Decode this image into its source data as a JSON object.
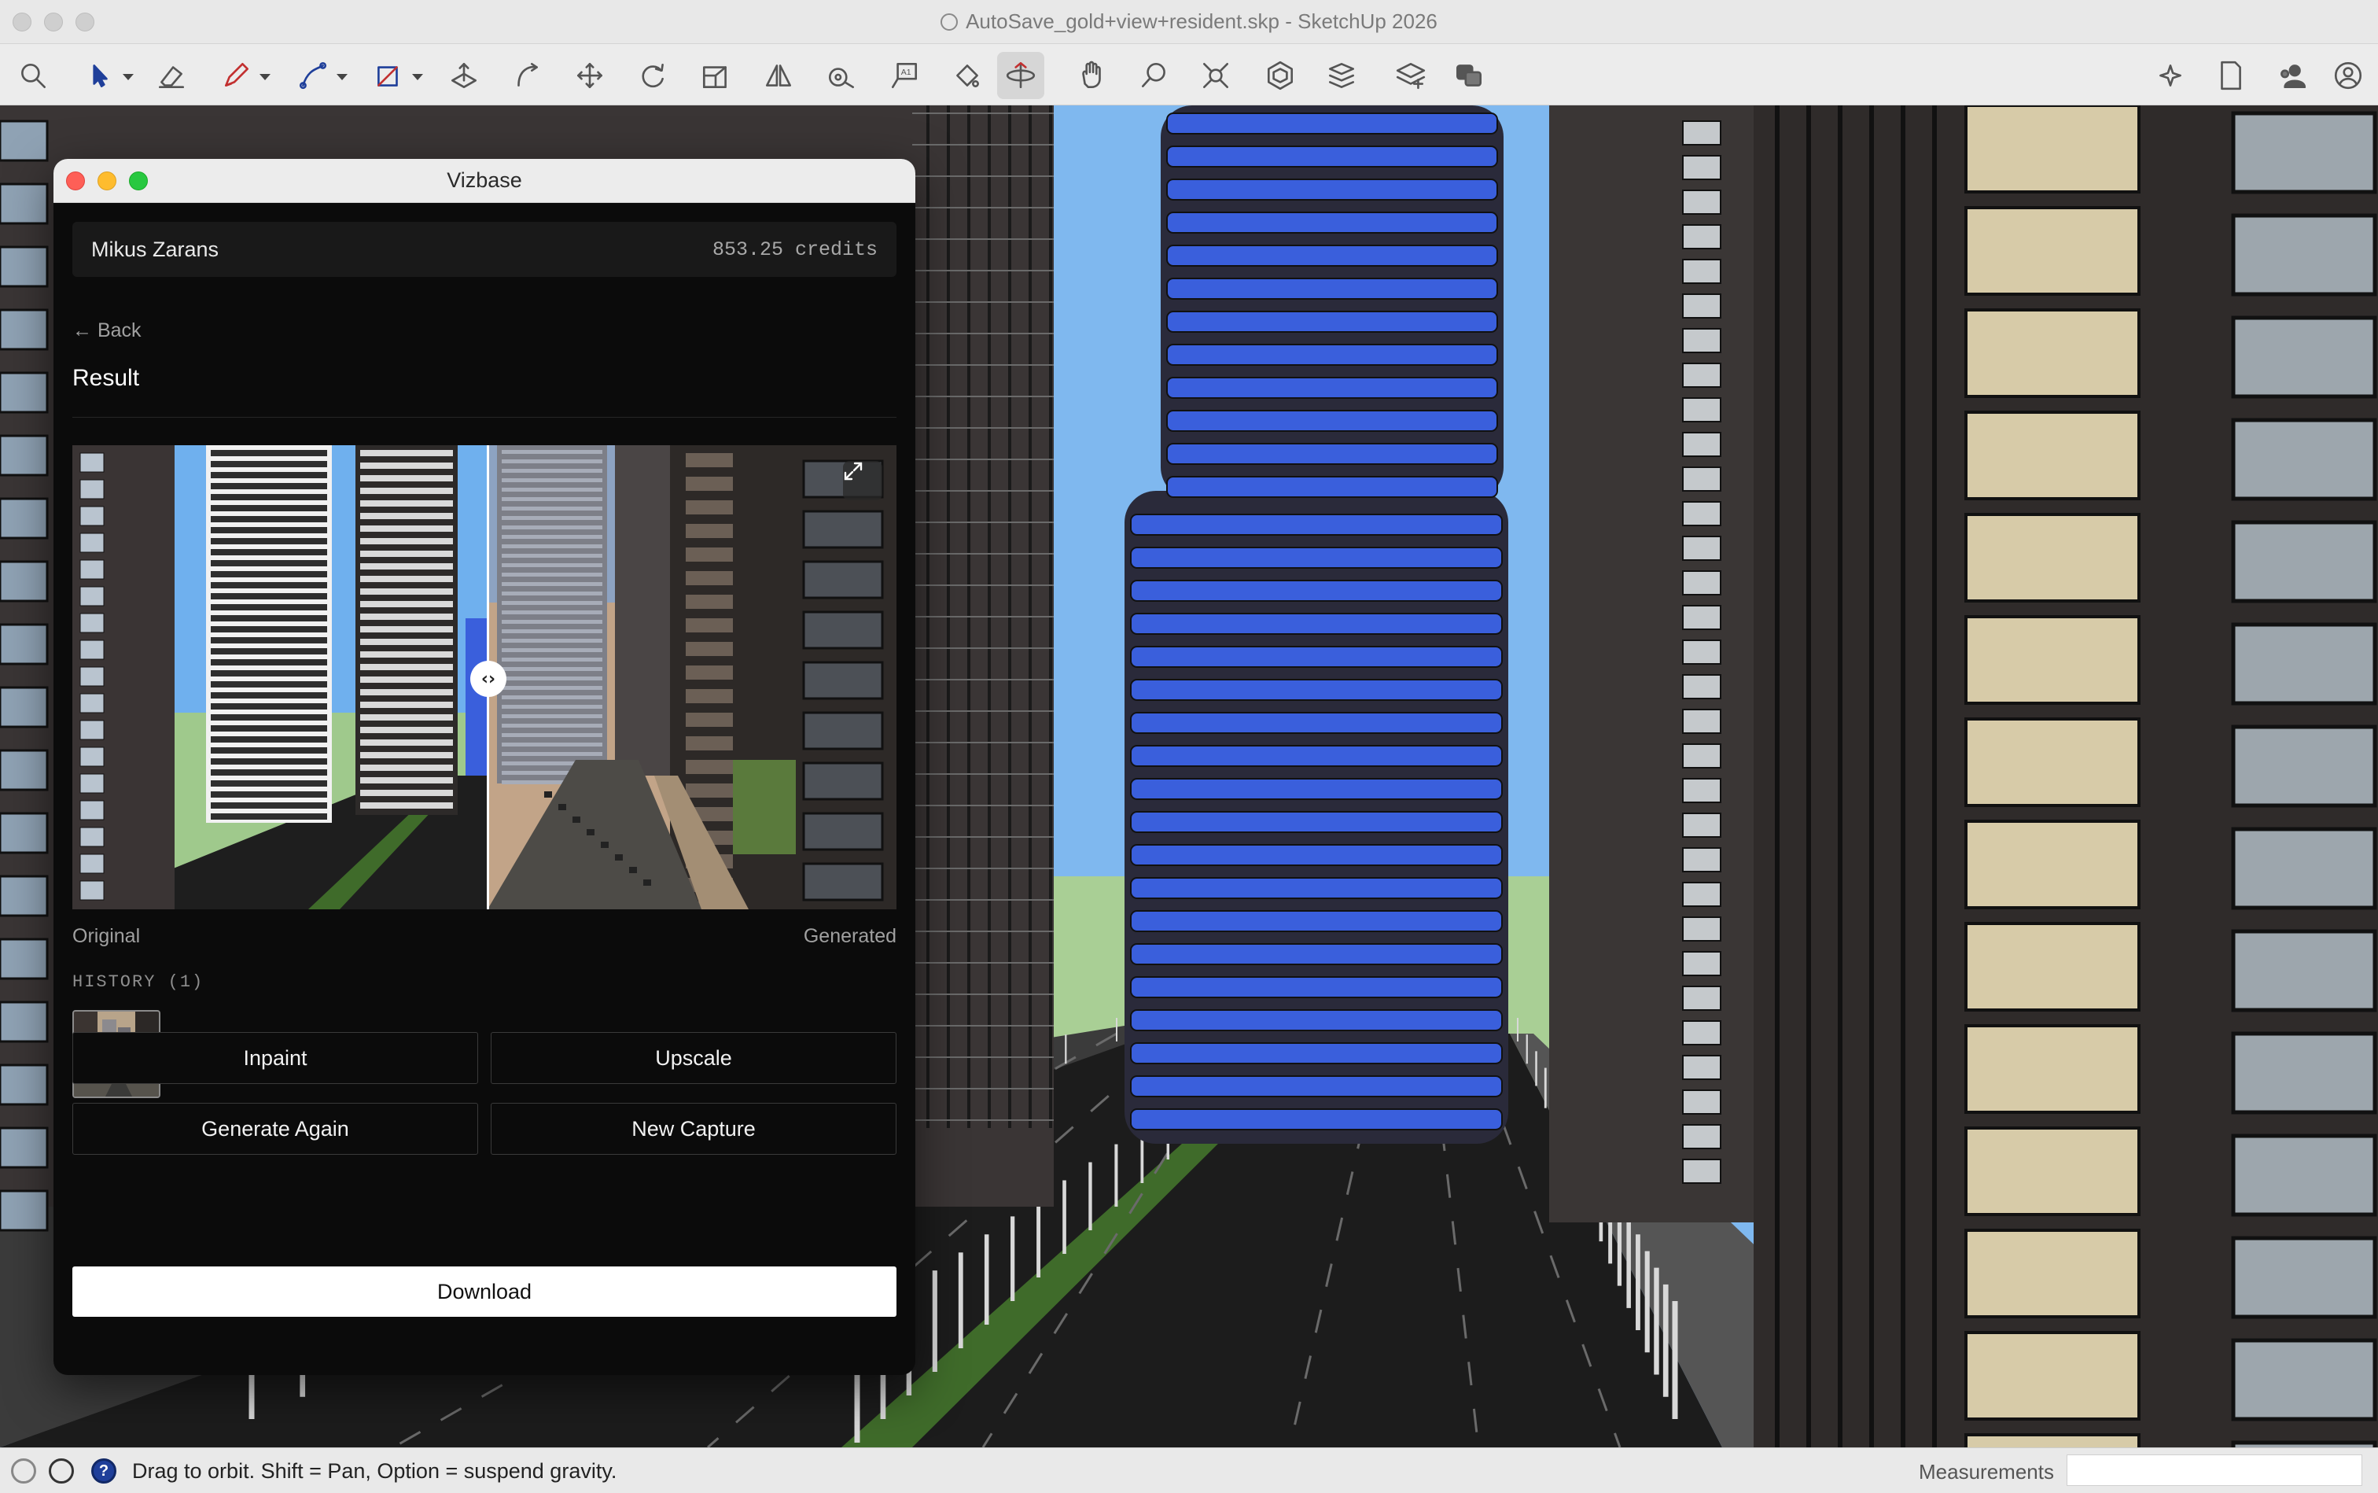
{
  "app": {
    "window_title": "AutoSave_gold+view+resident.skp - SketchUp 2026"
  },
  "toolbar": {
    "tools": [
      "search-icon",
      "select-icon",
      "eraser-icon",
      "pencil-icon",
      "line-icon",
      "rectangle-icon",
      "push-pull-icon",
      "follow-me-icon",
      "move-icon",
      "rotate-icon",
      "scale-icon",
      "flip-icon",
      "tape-measure-icon",
      "text-label-icon",
      "paint-bucket-icon",
      "orbit-icon",
      "pan-icon",
      "zoom-icon",
      "zoom-extents-icon",
      "components-icon",
      "materials-icon",
      "layers-icon",
      "scenes-icon",
      "ai-sparkle-icon",
      "document-icon",
      "users-icon",
      "account-icon"
    ],
    "active_tool": "orbit-icon"
  },
  "panel": {
    "title": "Vizbase",
    "user_name": "Mikus Zarans",
    "credits": "853.25 credits",
    "back_label": "← Back",
    "result_title": "Result",
    "label_original": "Original",
    "label_generated": "Generated",
    "history_label": "HISTORY (1)",
    "buttons": {
      "inpaint": "Inpaint",
      "upscale": "Upscale",
      "generate_again": "Generate Again",
      "new_capture": "New Capture",
      "download": "Download"
    }
  },
  "status": {
    "hint": "Drag to orbit. Shift = Pan, Option = suspend gravity.",
    "measurements_label": "Measurements",
    "measurements_value": ""
  },
  "colors": {
    "sky": "#7fb8ef",
    "tower_blue": "#3a5fdc",
    "building_dark": "#3a3535",
    "balcony_tan": "#d7cba8",
    "road": "#1c1c1c",
    "median_green": "#3f6b2a",
    "panel_bg": "#0b0b0b"
  }
}
